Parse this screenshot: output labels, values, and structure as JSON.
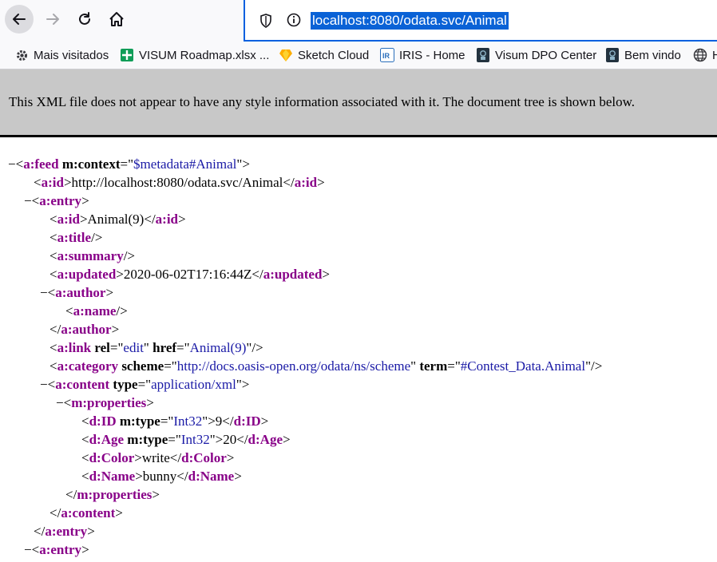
{
  "toolbar": {
    "url": "localhost:8080/odata.svc/Animal"
  },
  "bookmarks": [
    {
      "label": "Mais visitados",
      "icon": "gear-icon"
    },
    {
      "label": "VISUM Roadmap.xlsx ...",
      "icon": "sheets-icon"
    },
    {
      "label": "Sketch Cloud",
      "icon": "sketch-icon"
    },
    {
      "label": "IRIS - Home",
      "icon": "iris-icon"
    },
    {
      "label": "Visum DPO Center",
      "icon": "visum-icon"
    },
    {
      "label": "Bem vindo",
      "icon": "visum-icon"
    },
    {
      "label": "H",
      "icon": "globe-icon"
    }
  ],
  "notice": {
    "text": "This XML file does not appear to have any style information associated with it. The document tree is shown below."
  },
  "xml": {
    "collapse_marker": "−",
    "feed_tag": "a:feed",
    "feed_attr_name": "m:context",
    "feed_attr_value": "$metadata#Animal",
    "id_tag": "a:id",
    "feed_id_value": "http://localhost:8080/odata.svc/Animal",
    "entry_tag": "a:entry",
    "entry_id_value": "Animal(9)",
    "title_tag": "a:title",
    "summary_tag": "a:summary",
    "updated_tag": "a:updated",
    "updated_value": "2020-06-02T17:16:44Z",
    "author_tag": "a:author",
    "name_tag": "a:name",
    "link_tag": "a:link",
    "link_rel_name": "rel",
    "link_rel_value": "edit",
    "link_href_name": "href",
    "link_href_value": "Animal(9)",
    "category_tag": "a:category",
    "category_scheme_name": "scheme",
    "category_scheme_value": "http://docs.oasis-open.org/odata/ns/scheme",
    "category_term_name": "term",
    "category_term_value": "#Contest_Data.Animal",
    "content_tag": "a:content",
    "content_type_name": "type",
    "content_type_value": "application/xml",
    "properties_tag": "m:properties",
    "prop_type_attr": "m:type",
    "id_prop_tag": "d:ID",
    "id_prop_type": "Int32",
    "id_prop_value": "9",
    "age_tag": "d:Age",
    "age_type": "Int32",
    "age_value": "20",
    "color_tag": "d:Color",
    "color_value": "write",
    "name_prop_tag": "d:Name",
    "name_prop_value": "bunny"
  }
}
